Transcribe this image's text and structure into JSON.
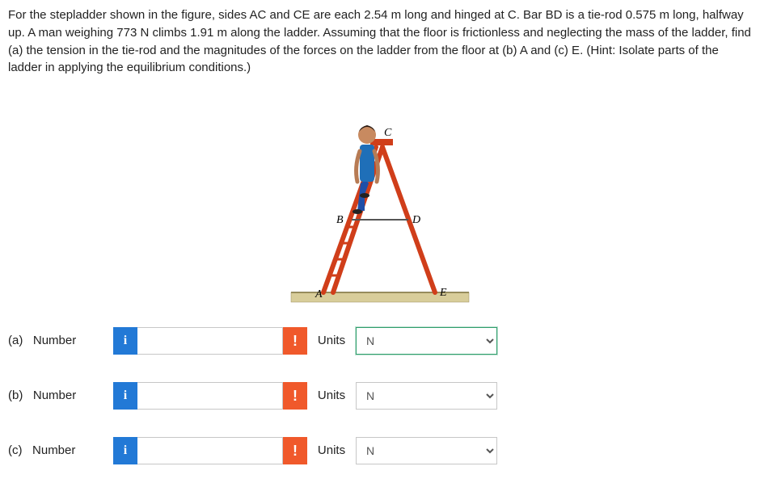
{
  "question": "For the stepladder shown in the figure, sides AC and CE are each 2.54 m long and hinged at C. Bar BD is a tie-rod 0.575 m long, halfway up. A man weighing 773 N climbs 1.91 m along the ladder. Assuming that the floor is frictionless and neglecting the mass of the ladder, find (a) the tension in the tie-rod and the magnitudes of the forces on the ladder from the floor at (b) A and (c) E. (Hint: Isolate parts of the ladder in applying the equilibrium conditions.)",
  "figure": {
    "labels": {
      "A": "A",
      "B": "B",
      "C": "C",
      "D": "D",
      "E": "E"
    }
  },
  "rows": [
    {
      "part": "(a)",
      "number_label": "Number",
      "info": "i",
      "warn": "!",
      "units_label": "Units",
      "unit_selected": "N",
      "highlight": true
    },
    {
      "part": "(b)",
      "number_label": "Number",
      "info": "i",
      "warn": "!",
      "units_label": "Units",
      "unit_selected": "N",
      "highlight": false
    },
    {
      "part": "(c)",
      "number_label": "Number",
      "info": "i",
      "warn": "!",
      "units_label": "Units",
      "unit_selected": "N",
      "highlight": false
    }
  ]
}
